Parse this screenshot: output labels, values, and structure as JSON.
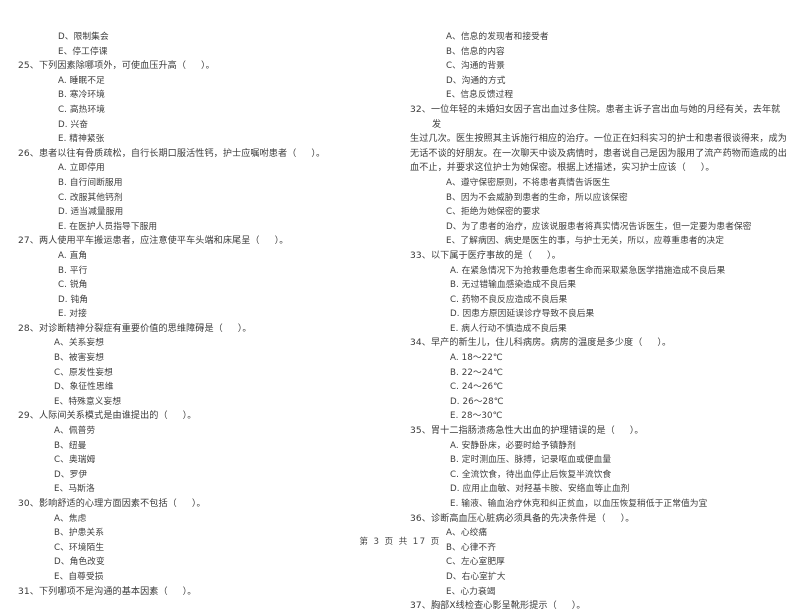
{
  "document": {
    "page_footer": "第 3 页 共 17 页",
    "page_number": "3",
    "total_pages": "17"
  },
  "left_column": {
    "leading_options": [
      "D、限制集会",
      "E、停工停课"
    ],
    "questions": [
      {
        "number": "25",
        "stem": "25、下列因素除哪项外，可使血压升高（     ）。",
        "options": [
          "A. 睡眠不足",
          "B. 寒冷环境",
          "C. 高热环境",
          "D. 兴奋",
          "E. 精神紧张"
        ]
      },
      {
        "number": "26",
        "stem": "26、患者以往有骨质疏松，自行长期口服活性钙，护士应嘱咐患者（     ）。",
        "options": [
          "A. 立即停用",
          "B. 自行间断服用",
          "C. 改服其他钙剂",
          "D. 适当减量服用",
          "E. 在医护人员指导下服用"
        ]
      },
      {
        "number": "27",
        "stem": "27、两人使用平车搬运患者，应注意使平车头端和床尾呈（     ）。",
        "options": [
          "A. 直角",
          "B. 平行",
          "C. 锐角",
          "D. 钝角",
          "E. 对接"
        ]
      },
      {
        "number": "28",
        "stem": "28、对诊断精神分裂症有重要价值的思维障碍是（     ）。",
        "options": [
          "A、关系妄想",
          "B、被害妄想",
          "C、原发性妄想",
          "D、象征性思维",
          "E、特殊意义妄想"
        ]
      },
      {
        "number": "29",
        "stem": "29、人际间关系模式是由谁提出的（     ）。",
        "options": [
          "A、佩普劳",
          "B、纽曼",
          "C、奥瑞姆",
          "D、罗伊",
          "E、马斯洛"
        ]
      },
      {
        "number": "30",
        "stem": "30、影响舒适的心理方面因素不包括（     ）。",
        "options": [
          "A、焦虑",
          "B、护患关系",
          "C、环境陌生",
          "D、角色改变",
          "E、自尊受损"
        ]
      },
      {
        "number": "31",
        "stem": "31、下列哪项不是沟通的基本因素（     ）。",
        "options": []
      }
    ]
  },
  "right_column": {
    "leading_options": [
      "A、信息的发现者和接受者",
      "B、信息的内容",
      "C、沟通的背景",
      "D、沟通的方式",
      "E、信息反馈过程"
    ],
    "questions": [
      {
        "number": "32",
        "stem_lines": [
          "32、一位年轻的未婚妇女因子宫出血过多住院。患者主诉子宫出血与她的月经有关，去年就发",
          "生过几次。医生按照其主诉施行相应的治疗。一位正在妇科实习的护士和患者很谈得来，成为",
          "无话不谈的好朋友。在一次聊天中谈及病情时，患者说自己是因为服用了流产药物而造成的出",
          "血不止，并要求这位护士为她保密。根据上述描述，实习护士应该（     ）。"
        ],
        "options": [
          "A、遵守保密原则，不将患者真情告诉医生",
          "B、因为不会威胁到患者的生命，所以应该保密",
          "C、拒绝为她保密的要求",
          "D、为了患者的治疗，应该说服患者将真实情况告诉医生，但一定要为患者保密",
          "E、了解病因、病史是医生的事，与护士无关，所以，应尊重患者的决定"
        ]
      },
      {
        "number": "33",
        "stem": "33、以下属于医疗事故的是（     ）。",
        "options": [
          "A. 在紧急情况下为抢救垂危患者生命而采取紧急医学措施造成不良后果",
          "B. 无过错输血感染造成不良后果",
          "C. 药物不良反应造成不良后果",
          "D. 因患方原因延误诊疗导致不良后果",
          "E. 病人行动不慎造成不良后果"
        ]
      },
      {
        "number": "34",
        "stem": "34、早产的新生儿，住儿科病房。病房的温度是多少度（     ）。",
        "options": [
          "A. 18～22℃",
          "B. 22～24℃",
          "C. 24～26℃",
          "D. 26～28℃",
          "E. 28～30℃"
        ]
      },
      {
        "number": "35",
        "stem": "35、胃十二指肠溃疡急性大出血的护理错误的是（     ）。",
        "options": [
          "A. 安静卧床，必要时给予镇静剂",
          "B. 定时测血压、脉搏，记录呕血或便血量",
          "C. 全流饮食，待出血停止后恢复半流饮食",
          "D. 应用止血敏、对羟基卡胺、安络血等止血剂",
          "E. 输液、输血治疗休克和纠正贫血，以血压恢复稍低于正常值为宜"
        ]
      },
      {
        "number": "36",
        "stem": "36、诊断高血压心脏病必须具备的先决条件是（     ）。",
        "options": [
          "A、心绞痛",
          "B、心律不齐",
          "C、左心室肥厚",
          "D、右心室扩大",
          "E、心力衰竭"
        ]
      },
      {
        "number": "37",
        "stem": "37、胸部X线检查心影呈靴形提示（     ）。",
        "options": []
      }
    ]
  }
}
